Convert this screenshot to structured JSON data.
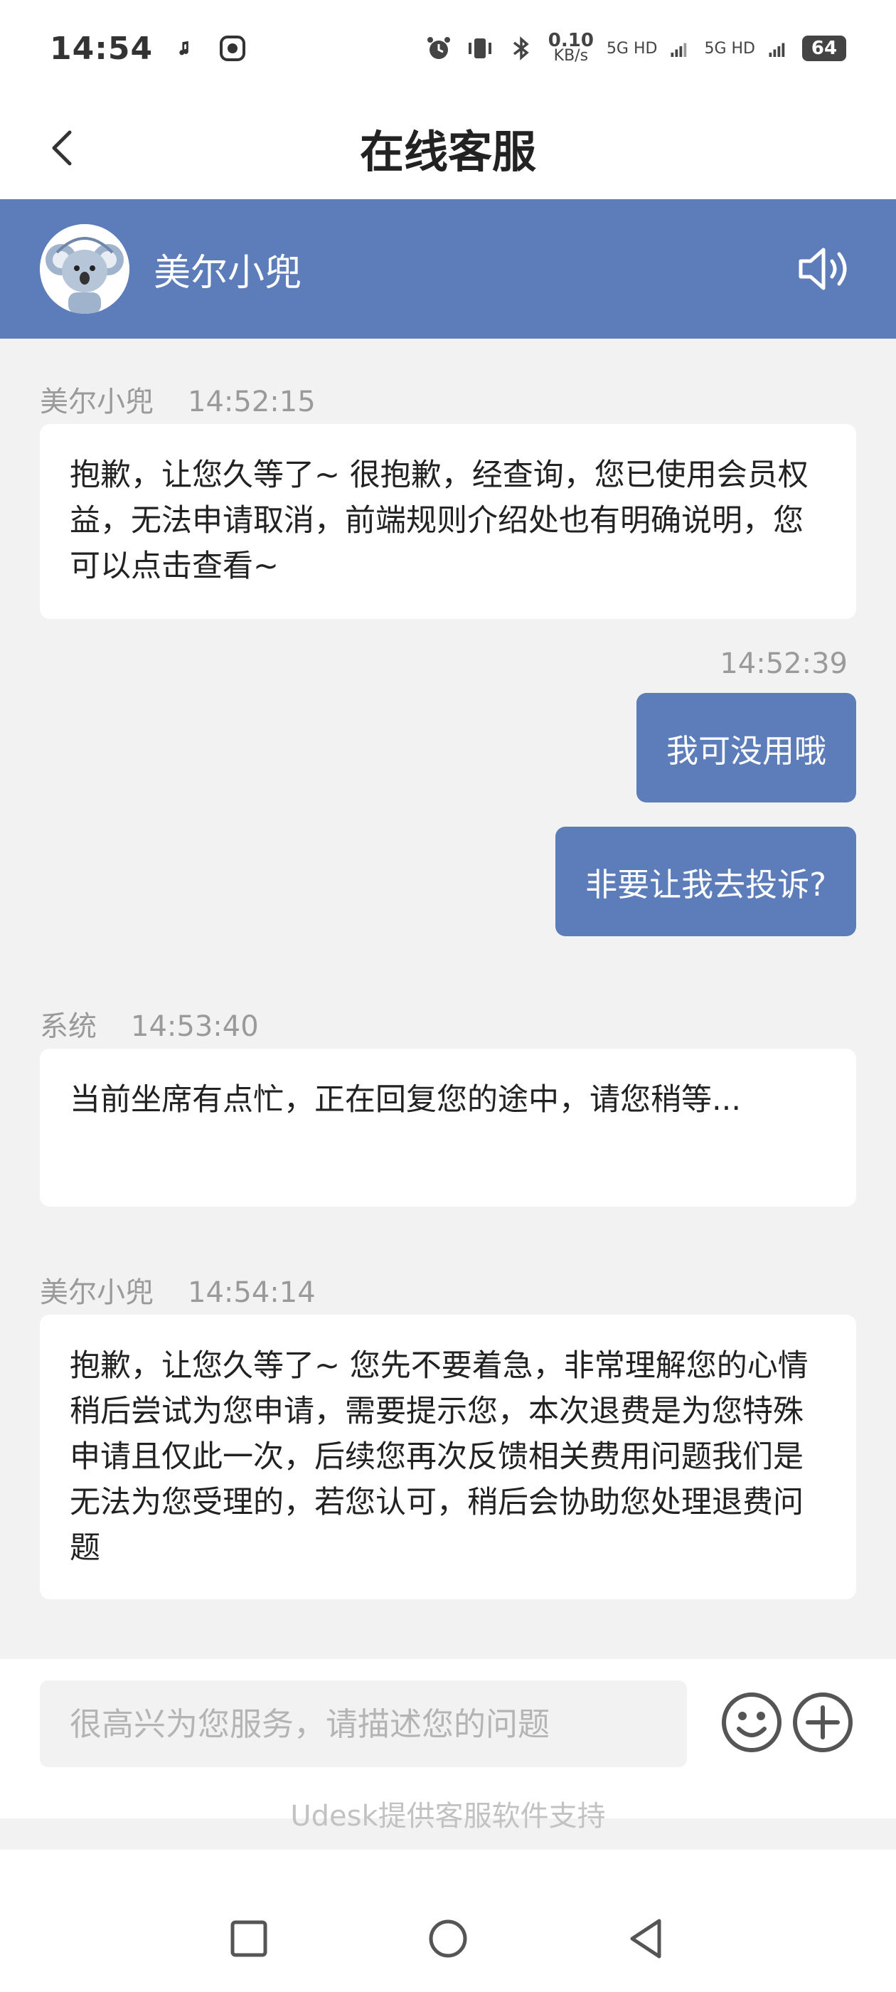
{
  "status_bar": {
    "time": "14:54",
    "net_speed_value": "0.10",
    "net_speed_unit": "KB/s",
    "signal_1": "5G HD",
    "signal_2": "5G HD",
    "battery": "64",
    "icons": [
      "notification-icon",
      "app-icon",
      "alarm-icon",
      "vibrate-icon",
      "bluetooth-icon"
    ]
  },
  "header": {
    "title": "在线客服"
  },
  "agent": {
    "name": "美尔小兜"
  },
  "messages": [
    {
      "direction": "in",
      "sender": "美尔小兜",
      "time": "14:52:15",
      "text": "抱歉，让您久等了~ 很抱歉，经查询，您已使用会员权益，无法申请取消，前端规则介绍处也有明确说明，您可以点击查看~"
    },
    {
      "direction": "out",
      "time": "14:52:39",
      "text": "我可没用哦"
    },
    {
      "direction": "out",
      "text": "非要让我去投诉?"
    },
    {
      "direction": "in",
      "sender": "系统",
      "time": "14:53:40",
      "text": "当前坐席有点忙，正在回复您的途中，请您稍等..."
    },
    {
      "direction": "in",
      "sender": "美尔小兜",
      "time": "14:54:14",
      "text": "抱歉，让您久等了~ 您先不要着急，非常理解您的心情 稍后尝试为您申请，需要提示您，本次退费是为您特殊申请且仅此一次，后续您再次反馈相关费用问题我们是无法为您受理的，若您认可，稍后会协助您处理退费问题"
    }
  ],
  "input": {
    "placeholder": "很高兴为您服务，请描述您的问题",
    "value": ""
  },
  "footer": {
    "powered_by": "Udesk提供客服软件支持"
  },
  "colors": {
    "accent": "#5c7cba",
    "background": "#f2f2f2",
    "bubble_in": "#ffffff",
    "bubble_out": "#5c7cba",
    "meta_text": "#9a9a9a"
  }
}
